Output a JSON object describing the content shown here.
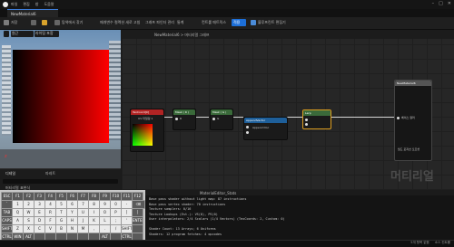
{
  "app": {
    "menu": [
      "파일",
      "편집",
      "창",
      "도움말"
    ],
    "tab_title": "NewMaterial6"
  },
  "toolbar": {
    "save_label": "저장",
    "items": [
      "탐색에서 찾기",
      "플랫폼 리로드",
      "매개변수 컬렉션 새로 고침",
      "그래프 파인더 관리",
      "통계",
      "프레뷰",
      "고정 제거",
      "컨트롤 매트릭스",
      "셰이더 컴파일"
    ],
    "apply_label": "적용",
    "extra": "블루프린트 편집기"
  },
  "viewport": {
    "chips": [
      "원근",
      "라이팅 포함"
    ],
    "axis": "z"
  },
  "details": {
    "tab_label": "디테일",
    "palette_label": "파레트",
    "section_label": "머티리얼 표현식",
    "search_placeholder": "검색"
  },
  "graph": {
    "breadcrumb": "NewMaterial6 > 머티리얼 그래프",
    "watermark": "머티리얼",
    "nodes": {
      "texcoord": {
        "title": "TexCoord[0]",
        "sub": "UV 타일링 1"
      },
      "mask1": {
        "title": "Mask ( R )",
        "pin": "R"
      },
      "mask2": {
        "title": "Mask ( G )",
        "pin": "G"
      },
      "append": {
        "title": "AppendVector",
        "pin_a": "A",
        "pin_b": "B",
        "label": "Append Doc"
      },
      "lerp": {
        "title": "Lerp"
      },
      "output": {
        "title": "NewMaterial6",
        "pin_out": "베이스 컬러",
        "footer": "월드 포지션 오프셋"
      }
    }
  },
  "keyboard": {
    "rows": [
      [
        "ESC",
        "F1",
        "F2",
        "F3",
        "F4",
        "F5",
        "F6",
        "F7",
        "F8",
        "F9",
        "F10",
        "F11",
        "F12"
      ],
      [
        "`",
        "1",
        "2",
        "3",
        "4",
        "5",
        "6",
        "7",
        "8",
        "9",
        "0",
        "-",
        "="
      ],
      [
        "TAB",
        "Q",
        "W",
        "E",
        "R",
        "T",
        "Y",
        "U",
        "I",
        "O",
        "P",
        "[",
        "]"
      ],
      [
        "CAPS",
        "A",
        "S",
        "D",
        "F",
        "G",
        "H",
        "J",
        "K",
        "L",
        ";",
        "'",
        "ENTER"
      ],
      [
        "SHIFT",
        "Z",
        "X",
        "C",
        "V",
        "B",
        "N",
        "M",
        ",",
        ".",
        "/",
        "SHIFT",
        ""
      ],
      [
        "CTRL",
        "WIN",
        "ALT",
        "",
        "",
        "",
        "",
        "",
        "",
        "ALT",
        "",
        "CTRL",
        ""
      ]
    ],
    "backspace": "⌫"
  },
  "stats": {
    "header": "MaterialEditor_Stats",
    "lines": [
      "Base pass shader without light map: 87 instructions",
      "Base pass vertex shader: 70 instructions",
      "Texture samplers: 0/16",
      "Texture Lookups (Est.): VS(0), PS(0)",
      "User interpolators: 2/4 Scalars (1/4 Vectors) (TexCoords: 2, Custom: 0)",
      "",
      "Shader Count: 13 Arrays; 6 Uniforms",
      "Shaders: 12 program fetches: 4 opcodes"
    ]
  },
  "statusbar": {
    "right": [
      "5개 항목 없음",
      "소스 컨트롤"
    ]
  }
}
